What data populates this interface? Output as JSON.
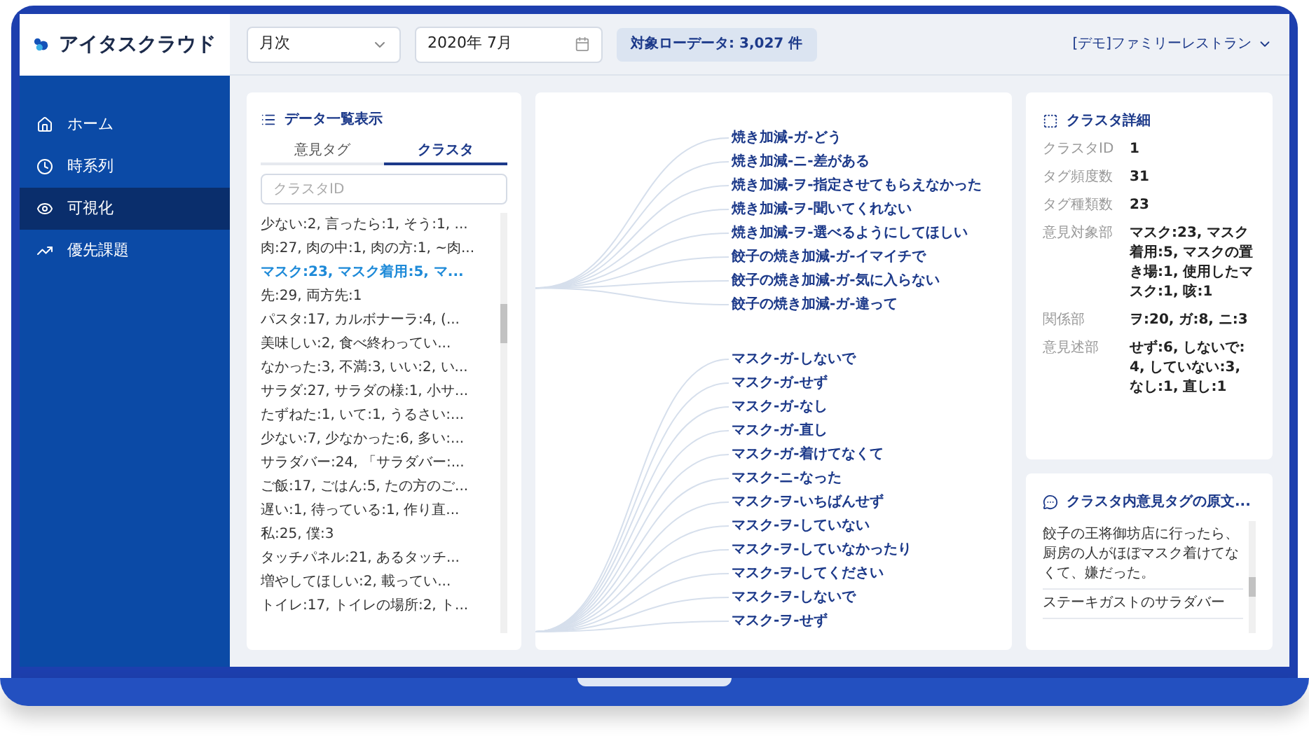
{
  "app": {
    "logo_text": "アイタスクラウド"
  },
  "sidebar": {
    "items": [
      {
        "label": "ホーム",
        "selected": false
      },
      {
        "label": "時系列",
        "selected": false
      },
      {
        "label": "可視化",
        "selected": true
      },
      {
        "label": "優先課題",
        "selected": false
      }
    ]
  },
  "toolbar": {
    "period_select": {
      "value": "月次"
    },
    "month_field": {
      "value": "2020年 7月"
    },
    "count_badge": "対象ローデータ: 3,027 件",
    "account_menu": "[デモ]ファミリーレストラン"
  },
  "data_list": {
    "title": "データ一覧表示",
    "tabs": [
      {
        "label": "意見タグ",
        "selected": false
      },
      {
        "label": "クラスタ",
        "selected": true
      }
    ],
    "search": {
      "placeholder": "クラスタID"
    },
    "items": [
      {
        "text": "少ない:2, 言ったら:1, そう:1, ...",
        "selected": false
      },
      {
        "text": "肉:27, 肉の中:1, 肉の方:1, ~肉...",
        "selected": false
      },
      {
        "text": "マスク:23, マスク着用:5, マ...",
        "selected": true
      },
      {
        "text": "先:29, 両方先:1",
        "selected": false
      },
      {
        "text": "パスタ:17, カルボナーラ:4, (...",
        "selected": false
      },
      {
        "text": "美味しい:2, 食べ終わってい...",
        "selected": false
      },
      {
        "text": "なかった:3, 不満:3, いい:2, い...",
        "selected": false
      },
      {
        "text": "サラダ:27, サラダの様:1, 小サ...",
        "selected": false
      },
      {
        "text": "たずねた:1, いて:1, うるさい:...",
        "selected": false
      },
      {
        "text": "少ない:7, 少なかった:6, 多い:...",
        "selected": false
      },
      {
        "text": "サラダバー:24, 「サラダバー:...",
        "selected": false
      },
      {
        "text": "ご飯:17, ごはん:5, たの方のご...",
        "selected": false
      },
      {
        "text": "遅い:1, 待っている:1, 作り直...",
        "selected": false
      },
      {
        "text": "私:25, 僕:3",
        "selected": false
      },
      {
        "text": "タッチパネル:21, あるタッチ...",
        "selected": false
      },
      {
        "text": "増やしてほしい:2, 載ってい...",
        "selected": false
      },
      {
        "text": "トイレ:17, トイレの場所:2, ト...",
        "selected": false
      }
    ]
  },
  "tag_tree": {
    "groups": [
      {
        "labels": [
          "焼き加減-ガ-どう",
          "焼き加減-ニ-差がある",
          "焼き加減-ヲ-指定させてもらえなかった",
          "焼き加減-ヲ-聞いてくれない",
          "焼き加減-ヲ-選べるようにしてほしい",
          "餃子の焼き加減-ガ-イマイチで",
          "餃子の焼き加減-ガ-気に入らない",
          "餃子の焼き加減-ガ-違って"
        ]
      },
      {
        "labels": [
          "マスク-ガ-しないで",
          "マスク-ガ-せず",
          "マスク-ガ-なし",
          "マスク-ガ-直し",
          "マスク-ガ-着けてなくて",
          "マスク-ニ-なった",
          "マスク-ヲ-いちばんせず",
          "マスク-ヲ-していない",
          "マスク-ヲ-していなかったり",
          "マスク-ヲ-してください",
          "マスク-ヲ-しないで",
          "マスク-ヲ-せず"
        ]
      }
    ]
  },
  "cluster_detail": {
    "title": "クラスタ詳細",
    "fields": [
      {
        "label": "クラスタID",
        "value": "1"
      },
      {
        "label": "タグ頻度数",
        "value": "31"
      },
      {
        "label": "タグ種類数",
        "value": "23"
      },
      {
        "label": "意見対象部",
        "value": "マスク:23, マスク着用:5, マスクの置き場:1, 使用したマスク:1, 咳:1"
      },
      {
        "label": "関係部",
        "value": "ヲ:20, ガ:8, ニ:3"
      },
      {
        "label": "意見述部",
        "value": "せず:6, しないで:4, していない:3, なし:1, 直し:1"
      }
    ]
  },
  "source_texts": {
    "title": "クラスタ内意見タグの原文...",
    "items": [
      "餃子の王将御坊店に行ったら、厨房の人がほぼマスク着けてなくて、嫌だった。",
      "ステーキガストのサラダバー"
    ]
  }
}
